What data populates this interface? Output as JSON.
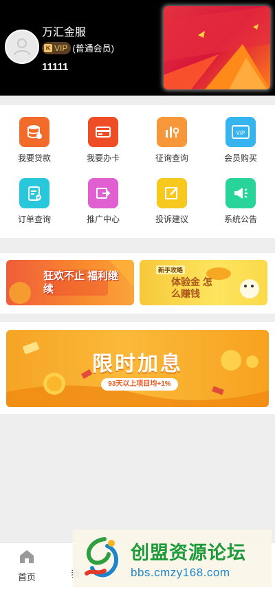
{
  "header": {
    "username": "万汇金服",
    "vip_label": "VIP",
    "member_type": "(普通会员)",
    "user_id": "11111"
  },
  "menu": [
    {
      "label": "我要贷款",
      "icon": "database-icon",
      "color": "#f26b2a"
    },
    {
      "label": "我要办卡",
      "icon": "credit-card-icon",
      "color": "#ef4d25"
    },
    {
      "label": "征询查询",
      "icon": "chart-search-icon",
      "color": "#f7973a"
    },
    {
      "label": "会员购买",
      "icon": "vip-card-icon",
      "color": "#35b4f0"
    },
    {
      "label": "订单查询",
      "icon": "clipboard-check-icon",
      "color": "#28c7db"
    },
    {
      "label": "推广中心",
      "icon": "share-icon",
      "color": "#e05fd1"
    },
    {
      "label": "投诉建议",
      "icon": "edit-icon",
      "color": "#f7c81e"
    },
    {
      "label": "系统公告",
      "icon": "megaphone-icon",
      "color": "#29d49a"
    }
  ],
  "banners": {
    "left_text": "狂欢不止 福利继续",
    "right_tag": "新手攻略",
    "right_text": "体验金 怎么赚钱",
    "promo_title": "限时加息",
    "promo_sub": "93天以上项目均+1%"
  },
  "tabbar": {
    "home_label": "首页",
    "second_label": "我"
  },
  "watermark": {
    "name": "创盟资源论坛",
    "url": "bbs.cmzy168.com"
  }
}
